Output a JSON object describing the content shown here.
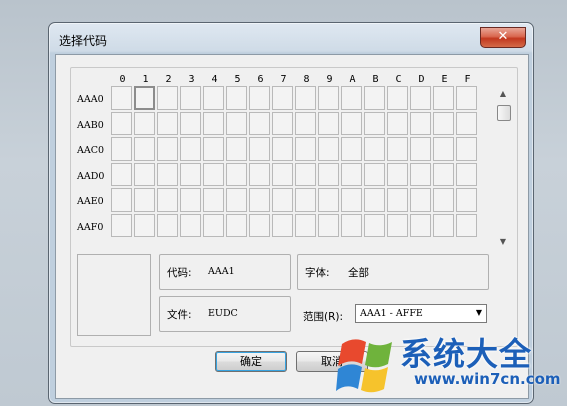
{
  "window": {
    "title": "选择代码",
    "close_glyph": "✕"
  },
  "grid": {
    "columns": [
      "0",
      "1",
      "2",
      "3",
      "4",
      "5",
      "6",
      "7",
      "8",
      "9",
      "A",
      "B",
      "C",
      "D",
      "E",
      "F"
    ],
    "rows": [
      "AAA0",
      "AAB0",
      "AAC0",
      "AAD0",
      "AAE0",
      "AAF0"
    ],
    "selected": {
      "row": 0,
      "col": 1
    }
  },
  "info": {
    "code_label": "代码:",
    "code_value": "AAA1",
    "font_label": "字体:",
    "font_value": "全部",
    "file_label": "文件:",
    "file_value": "EUDC",
    "range_label": "范围(R):",
    "range_value": "AAA1 - AFFE"
  },
  "buttons": {
    "ok": "确定",
    "cancel": "取消"
  },
  "watermark": {
    "brand": "系统大全",
    "url": "www.win7cn.com"
  },
  "icons": {
    "scroll_up": "▲",
    "scroll_down": "▼",
    "dropdown": "▼"
  }
}
